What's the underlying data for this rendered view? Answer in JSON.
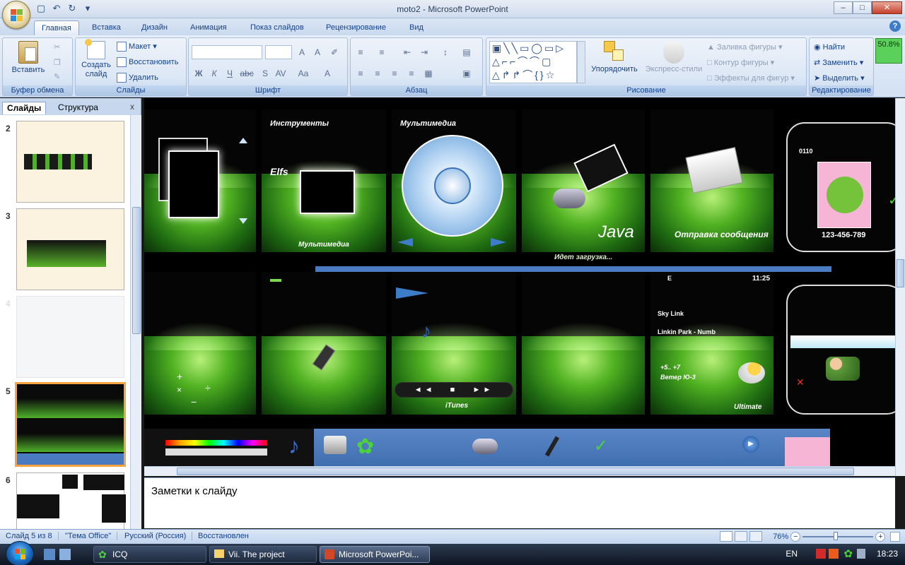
{
  "window": {
    "title": "moto2 - Microsoft PowerPoint"
  },
  "tabs": [
    "Главная",
    "Вставка",
    "Дизайн",
    "Анимация",
    "Показ слайдов",
    "Рецензирование",
    "Вид"
  ],
  "ribbon": {
    "clipboard": {
      "paste": "Вставить",
      "label": "Буфер обмена"
    },
    "slides": {
      "new_slide": "Создать слайд",
      "layout": "Макет",
      "reset": "Восстановить",
      "delete": "Удалить",
      "label": "Слайды"
    },
    "font": {
      "label": "Шрифт"
    },
    "paragraph": {
      "label": "Абзац"
    },
    "drawing": {
      "arrange": "Упорядочить",
      "quick_styles": "Экспресс-стили",
      "fill": "Заливка фигуры",
      "outline": "Контур фигуры",
      "effects": "Эффекты для фигур",
      "label": "Рисование"
    },
    "editing": {
      "find": "Найти",
      "replace": "Заменить",
      "select": "Выделить",
      "label": "Редактирование"
    },
    "zoom_badge": "50.8%"
  },
  "panel": {
    "tab_slides": "Слайды",
    "tab_outline": "Структура",
    "close": "x",
    "thumb_numbers": [
      "2",
      "3",
      "4",
      "5",
      "6"
    ]
  },
  "slide": {
    "labels": {
      "instruments": "Инструменты",
      "multimedia_title": "Мультимедиа",
      "multimedia": "Мультимедиа",
      "java": "Java",
      "loading": "Идет загрузка...",
      "send_message": "Отправка сообщения",
      "code": "0110",
      "phone": "123-456-789",
      "clock": "11:25",
      "operator": "Sky Link",
      "track": "Linkin Park - Numb",
      "weather_temp": "+5.. +7",
      "weather_wind": "Ветер Ю-3",
      "itunes": "iTunes",
      "ultimate": "Ultimate",
      "elfs": "Elfs",
      "signal": "E"
    }
  },
  "notes": {
    "placeholder": "Заметки к слайду"
  },
  "status": {
    "slide": "Слайд 5 из 8",
    "theme": "\"Тема Office\"",
    "language": "Русский (Россия)",
    "state": "Восстановлен",
    "zoom": "76%"
  },
  "taskbar": {
    "items": [
      "ICQ",
      "Vii. The project",
      "Microsoft PowerPoi..."
    ],
    "lang": "EN",
    "time": "18:23"
  }
}
